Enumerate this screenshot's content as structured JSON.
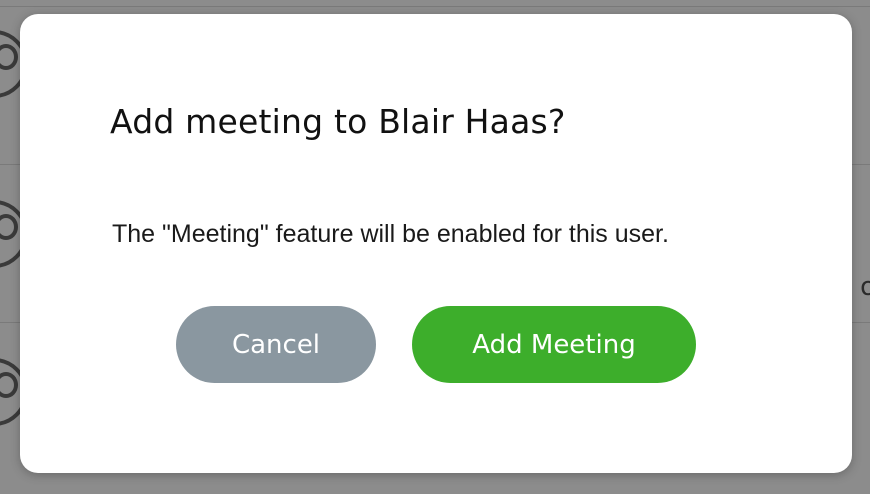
{
  "dialog": {
    "title": "Add meeting to Blair Haas?",
    "message": "The \"Meeting\" feature will be enabled for this user.",
    "cancel_label": "Cancel",
    "confirm_label": "Add Meeting"
  },
  "background": {
    "partial_text": "o"
  },
  "colors": {
    "cancel_button": "#8a97a0",
    "confirm_button": "#3dae2b",
    "overlay": "#8c8c8c",
    "dialog_bg": "#ffffff"
  }
}
